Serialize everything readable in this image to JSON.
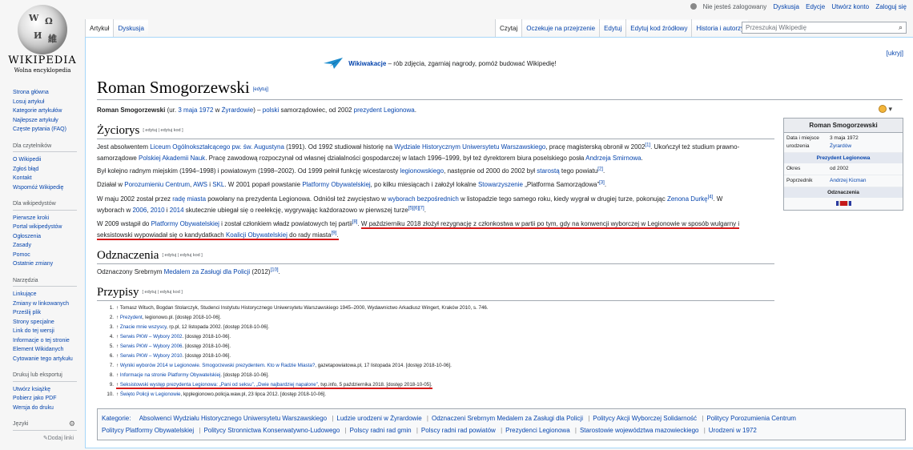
{
  "personal": {
    "anon": "Nie jesteś zalogowany",
    "links": [
      "Dyskusja",
      "Edycje",
      "Utwórz konto",
      "Zaloguj się"
    ]
  },
  "logo": {
    "title": "WIKIPEDIA",
    "subtitle": "Wolna encyklopedia"
  },
  "sidebar": {
    "nav": [
      "Strona główna",
      "Losuj artykuł",
      "Kategorie artykułów",
      "Najlepsze artykuły",
      "Częste pytania (FAQ)"
    ],
    "readers": {
      "heading": "Dla czytelników",
      "items": [
        "O Wikipedii",
        "Zgłoś błąd",
        "Kontakt",
        "Wspomóż Wikipedię"
      ]
    },
    "editors": {
      "heading": "Dla wikipedystów",
      "items": [
        "Pierwsze kroki",
        "Portal wikipedystów",
        "Ogłoszenia",
        "Zasady",
        "Pomoc",
        "Ostatnie zmiany"
      ]
    },
    "tools": {
      "heading": "Narzędzia",
      "items": [
        "Linkujące",
        "Zmiany w linkowanych",
        "Prześlij plik",
        "Strony specjalne",
        "Link do tej wersji",
        "Informacje o tej stronie",
        "Element Wikidanych",
        "Cytowanie tego artykułu"
      ]
    },
    "print": {
      "heading": "Drukuj lub eksportuj",
      "items": [
        "Utwórz książkę",
        "Pobierz jako PDF",
        "Wersja do druku"
      ]
    },
    "langs": {
      "heading": "Języki",
      "add": "Dodaj linki"
    }
  },
  "tabs": {
    "left": [
      "Artykuł",
      "Dyskusja"
    ],
    "right": [
      "Czytaj",
      "Oczekuje na przejrzenie",
      "Edytuj",
      "Edytuj kod źródłowy",
      "Historia i autorzy"
    ]
  },
  "search": {
    "placeholder": "Przeszukaj Wikipedię"
  },
  "notice": {
    "bold": "Wikiwakacje",
    "text": " – rób zdjęcia, zgarniaj nagrody, pomóż budować Wikipedię!",
    "hide": "[ukryj]"
  },
  "article": {
    "title": "Roman Smogorzewski",
    "edit": "[edytuj]",
    "lead": {
      "name": "Roman Smogorzewski",
      "p1": " (ur. ",
      "date": "3 maja 1972",
      "p2": " w ",
      "place": "Żyrardowie",
      "p3": ") – ",
      "nat": "polski",
      "p4": " samorządowiec, od 2002 ",
      "role": "prezydent",
      "p5": " ",
      "city": "Legionowa",
      "p6": "."
    },
    "sections": {
      "biography": "Życiorys",
      "awards": "Odznaczenia",
      "refs": "Przypisy",
      "edit2": "[ edytuj | edytuj kod ]"
    },
    "bio": {
      "p1a": "Jest absolwentem ",
      "p1b": "Liceum Ogólnokształcącego pw. św. Augustyna",
      "p1c": " (1991). Od 1992 studiował historię na ",
      "p1d": "Wydziale Historycznym Uniwersytetu Warszawskiego",
      "p1e": ", pracę magisterską obronił w 2002",
      "p1f": ". Ukończył też studium prawno-",
      "p1g": "samorządowe ",
      "p1h": "Polskiej Akademii Nauk",
      "p1i": ". Pracę zawodową rozpoczynał od własnej działalności gospodarczej w latach 1996–1999, był też dyrektorem biura poselskiego posła ",
      "p1j": "Andrzeja Smirnowa",
      "p1k": ".",
      "p2a": "Był kolejno radnym miejskim (1994–1998) i powiatowym (1998–2002). Od 1999 pełnił funkcję wicestarosty ",
      "p2b": "legionowskiego",
      "p2c": ", następnie od 2000 do 2002 był ",
      "p2d": "starostą",
      "p2e": " tego powiatu",
      "p3a": "Działał w ",
      "p3b": "Porozumieniu Centrum",
      "p3c": ", ",
      "p3d": "AWS",
      "p3e": " i ",
      "p3f": "SKL",
      "p3g": ". W 2001 poparł powstanie ",
      "p3h": "Platformy Obywatelskiej",
      "p3i": ", po kilku miesiącach i założył lokalne ",
      "p3j": "Stowarzyszenie",
      "p3k": " „Platforma Samorządowa”",
      "p4a": "W maju 2002 został przez ",
      "p4b": "radę miasta",
      "p4c": " powołany na prezydenta Legionowa. Odniósł też zwycięstwo w ",
      "p4d": "wyborach bezpośrednich",
      "p4e": " w listopadzie tego samego roku, kiedy wygrał w drugiej turze, pokonując ",
      "p4f": "Zenona Durkę",
      "p4g": ". W",
      "p4h": "wyborach w ",
      "p4i": "2006",
      "p4j": ", ",
      "p4k": "2010",
      "p4l": " i ",
      "p4m": "2014",
      "p4n": " skutecznie ubiegał się o reelekcję, wygrywając każdorazowo w pierwszej turze",
      "p5a": "W 2009 wstąpił do ",
      "p5b": "Platformy Obywatelskiej",
      "p5c": " i został członkiem władz powiatowych tej partii",
      "p5d": "W październiku 2018 złożył rezygnację z członkostwa w partii po tym, gdy na konwencji wyborczej w Legionowie w sposób wulgarny i",
      "p5e": "seksistowski wypowiadał się o kandydatkach ",
      "p5f": "Koalicji Obywatelskiej",
      "p5g": " do rady miasta"
    },
    "awards": {
      "a1": "Odznaczony Srebrnym ",
      "a2": "Medalem za Zasługi dla Policji",
      "a3": " (2012)",
      "sup": "[10]"
    },
    "sups": {
      "s1": "[1]",
      "s2": "[2]",
      "s3": "[3]",
      "s4": "[4]",
      "s5": "[5][6][7]",
      "s8": "[8]",
      "s9": "[9]"
    }
  },
  "refs": [
    {
      "n": "1.",
      "link": "",
      "text": "Tomasz Wituch, Bogdan Stolarczyk, Studenci Instytutu Historycznego Uniwersytetu Warszawskiego 1945–2000, Wydawnictwo Arkadiusz Wingert, Kraków 2010, s. 746."
    },
    {
      "n": "2.",
      "link": "Prezydent",
      "text": ", legionowo.pl. [dostęp 2018-10-06]."
    },
    {
      "n": "3.",
      "link": "Znacie mnie wszyscy",
      "text": ", rp.pl, 12 listopada 2002. [dostęp 2018-10-06]."
    },
    {
      "n": "4.",
      "link": "Serwis PKW – Wybory 2002",
      "text": ". [dostęp 2018-10-06]."
    },
    {
      "n": "5.",
      "link": "Serwis PKW – Wybory 2006",
      "text": ". [dostęp 2018-10-06]."
    },
    {
      "n": "6.",
      "link": "Serwis PKW – Wybory 2010",
      "text": ". [dostęp 2018-10-06]."
    },
    {
      "n": "7.",
      "link": "Wyniki wyborów 2014 w Legionowie. Smogorzewski prezydentem. Kto w Radzie Miasta?",
      "text": ", gazetapowiatowa.pl, 17 listopada 2014. [dostęp 2018-10-06]."
    },
    {
      "n": "8.",
      "link": "Informacje na stronie Platformy Obywatelskiej",
      "text": ". [dostęp 2018-10-06]."
    },
    {
      "n": "9.",
      "link": "Seksistowski występ prezydenta Legionowa: „Pani od seksu”, „Dwie najbardziej napalone”",
      "text": ", tvp.info, 5 października 2018. [dostęp 2018-10-05]."
    },
    {
      "n": "10.",
      "link": "Święto Policji w Legionowie",
      "text": ", kpplegionowo.policja.waw.pl, 23 lipca 2012. [dostęp 2018-10-06]."
    }
  ],
  "categories": {
    "label": "Kategorie:",
    "items": [
      "Absolwenci Wydziału Historycznego Uniwersytetu Warszawskiego",
      "Ludzie urodzeni w Żyrardowie",
      "Odznaczeni Srebrnym Medalem za Zasługi dla Policji",
      "Politycy Akcji Wyborczej Solidarność",
      "Politycy Porozumienia Centrum",
      "Politycy Platformy Obywatelskiej",
      "Politycy Stronnictwa Konserwatywno-Ludowego",
      "Polscy radni rad gmin",
      "Polscy radni rad powiatów",
      "Prezydenci Legionowa",
      "Starostowie województwa mazowieckiego",
      "Urodzeni w 1972"
    ]
  },
  "infobox": {
    "title": "Roman Smogorzewski",
    "born_label": "Data i miejsce urodzenia",
    "born_date": "3 maja 1972",
    "born_place": "Żyrardów",
    "office": "Prezydent Legionowa",
    "term_label": "Okres",
    "term_value": "od 2002",
    "pred_label": "Poprzednik",
    "pred_value": "Andrzej Kicman",
    "awards": "Odznaczenia"
  },
  "colors": {
    "underline": "#d61a1a",
    "link": "#0645ad",
    "redlink": "#ba0000"
  }
}
